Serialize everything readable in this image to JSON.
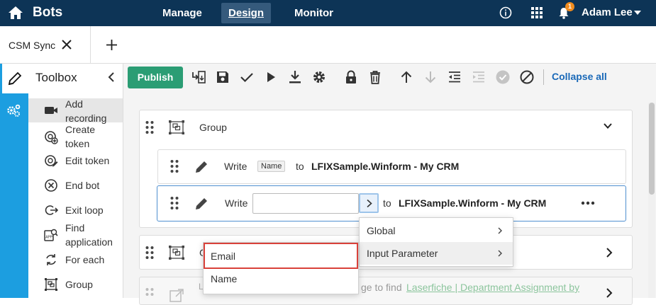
{
  "app": {
    "title": "Bots",
    "nav": [
      "Manage",
      "Design",
      "Monitor"
    ],
    "active_nav": "Design",
    "notification_count": "1",
    "user_name": "Adam Lee"
  },
  "tab": {
    "label": "CSM Sync"
  },
  "toolbox": {
    "title": "Toolbox",
    "items": [
      {
        "label": "Add recording",
        "icon": "video-camera-icon"
      },
      {
        "label": "Create token",
        "icon": "create-token-icon"
      },
      {
        "label": "Edit token",
        "icon": "edit-token-icon"
      },
      {
        "label": "End bot",
        "icon": "end-bot-icon"
      },
      {
        "label": "Exit loop",
        "icon": "exit-loop-icon"
      },
      {
        "label": "Find application",
        "icon": "find-application-icon"
      },
      {
        "label": "For each",
        "icon": "for-each-icon"
      },
      {
        "label": "Group",
        "icon": "group-icon"
      }
    ]
  },
  "toolbar": {
    "publish": "Publish",
    "collapse_all": "Collapse all"
  },
  "group1": {
    "title": "Group"
  },
  "step1": {
    "verb": "Write",
    "chip": "Name",
    "to": "to",
    "target": "LFIXSample.Winform - My CRM"
  },
  "step2": {
    "verb": "Write",
    "input_value": "",
    "to": "to",
    "target": "LFIXSample.Winform - My CRM"
  },
  "group2": {
    "title": "G"
  },
  "row3": {
    "prefix": "L",
    "middle": "ge to find",
    "link": "Laserfiche | Department Assignment by"
  },
  "menu_main": {
    "items": [
      "Global",
      "Input Parameter"
    ]
  },
  "menu_sub": {
    "items": [
      "Email",
      "Name"
    ]
  },
  "colors": {
    "topbar": "#0d3456",
    "rail": "#1c9ee0",
    "publish": "#2b9d74",
    "highlight_box": "#d9413a",
    "link": "#1a69b8"
  }
}
